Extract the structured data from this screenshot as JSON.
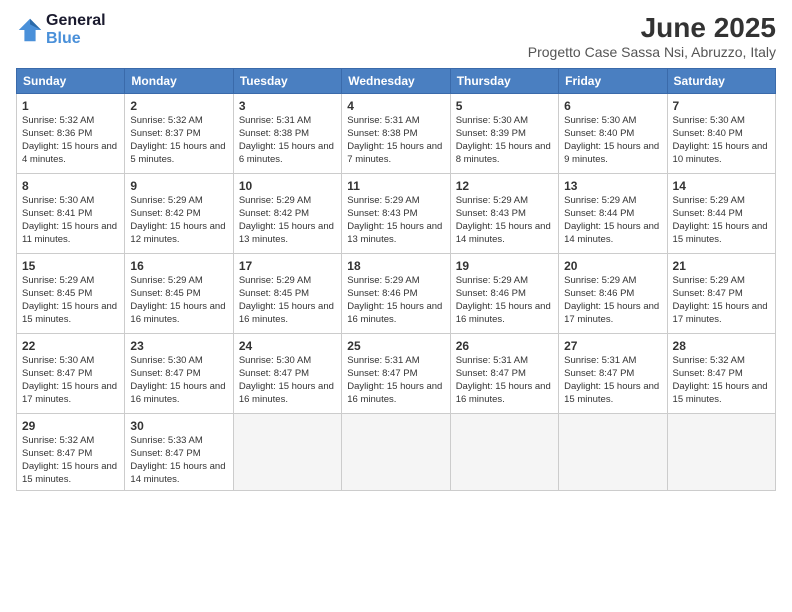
{
  "logo": {
    "line1": "General",
    "line2": "Blue"
  },
  "title": "June 2025",
  "subtitle": "Progetto Case Sassa Nsi, Abruzzo, Italy",
  "days_of_week": [
    "Sunday",
    "Monday",
    "Tuesday",
    "Wednesday",
    "Thursday",
    "Friday",
    "Saturday"
  ],
  "weeks": [
    [
      {
        "day": "1",
        "sunrise": "5:32 AM",
        "sunset": "8:36 PM",
        "daylight": "15 hours and 4 minutes."
      },
      {
        "day": "2",
        "sunrise": "5:32 AM",
        "sunset": "8:37 PM",
        "daylight": "15 hours and 5 minutes."
      },
      {
        "day": "3",
        "sunrise": "5:31 AM",
        "sunset": "8:38 PM",
        "daylight": "15 hours and 6 minutes."
      },
      {
        "day": "4",
        "sunrise": "5:31 AM",
        "sunset": "8:38 PM",
        "daylight": "15 hours and 7 minutes."
      },
      {
        "day": "5",
        "sunrise": "5:30 AM",
        "sunset": "8:39 PM",
        "daylight": "15 hours and 8 minutes."
      },
      {
        "day": "6",
        "sunrise": "5:30 AM",
        "sunset": "8:40 PM",
        "daylight": "15 hours and 9 minutes."
      },
      {
        "day": "7",
        "sunrise": "5:30 AM",
        "sunset": "8:40 PM",
        "daylight": "15 hours and 10 minutes."
      }
    ],
    [
      {
        "day": "8",
        "sunrise": "5:30 AM",
        "sunset": "8:41 PM",
        "daylight": "15 hours and 11 minutes."
      },
      {
        "day": "9",
        "sunrise": "5:29 AM",
        "sunset": "8:42 PM",
        "daylight": "15 hours and 12 minutes."
      },
      {
        "day": "10",
        "sunrise": "5:29 AM",
        "sunset": "8:42 PM",
        "daylight": "15 hours and 13 minutes."
      },
      {
        "day": "11",
        "sunrise": "5:29 AM",
        "sunset": "8:43 PM",
        "daylight": "15 hours and 13 minutes."
      },
      {
        "day": "12",
        "sunrise": "5:29 AM",
        "sunset": "8:43 PM",
        "daylight": "15 hours and 14 minutes."
      },
      {
        "day": "13",
        "sunrise": "5:29 AM",
        "sunset": "8:44 PM",
        "daylight": "15 hours and 14 minutes."
      },
      {
        "day": "14",
        "sunrise": "5:29 AM",
        "sunset": "8:44 PM",
        "daylight": "15 hours and 15 minutes."
      }
    ],
    [
      {
        "day": "15",
        "sunrise": "5:29 AM",
        "sunset": "8:45 PM",
        "daylight": "15 hours and 15 minutes."
      },
      {
        "day": "16",
        "sunrise": "5:29 AM",
        "sunset": "8:45 PM",
        "daylight": "15 hours and 16 minutes."
      },
      {
        "day": "17",
        "sunrise": "5:29 AM",
        "sunset": "8:45 PM",
        "daylight": "15 hours and 16 minutes."
      },
      {
        "day": "18",
        "sunrise": "5:29 AM",
        "sunset": "8:46 PM",
        "daylight": "15 hours and 16 minutes."
      },
      {
        "day": "19",
        "sunrise": "5:29 AM",
        "sunset": "8:46 PM",
        "daylight": "15 hours and 16 minutes."
      },
      {
        "day": "20",
        "sunrise": "5:29 AM",
        "sunset": "8:46 PM",
        "daylight": "15 hours and 17 minutes."
      },
      {
        "day": "21",
        "sunrise": "5:29 AM",
        "sunset": "8:47 PM",
        "daylight": "15 hours and 17 minutes."
      }
    ],
    [
      {
        "day": "22",
        "sunrise": "5:30 AM",
        "sunset": "8:47 PM",
        "daylight": "15 hours and 17 minutes."
      },
      {
        "day": "23",
        "sunrise": "5:30 AM",
        "sunset": "8:47 PM",
        "daylight": "15 hours and 16 minutes."
      },
      {
        "day": "24",
        "sunrise": "5:30 AM",
        "sunset": "8:47 PM",
        "daylight": "15 hours and 16 minutes."
      },
      {
        "day": "25",
        "sunrise": "5:31 AM",
        "sunset": "8:47 PM",
        "daylight": "15 hours and 16 minutes."
      },
      {
        "day": "26",
        "sunrise": "5:31 AM",
        "sunset": "8:47 PM",
        "daylight": "15 hours and 16 minutes."
      },
      {
        "day": "27",
        "sunrise": "5:31 AM",
        "sunset": "8:47 PM",
        "daylight": "15 hours and 15 minutes."
      },
      {
        "day": "28",
        "sunrise": "5:32 AM",
        "sunset": "8:47 PM",
        "daylight": "15 hours and 15 minutes."
      }
    ],
    [
      {
        "day": "29",
        "sunrise": "5:32 AM",
        "sunset": "8:47 PM",
        "daylight": "15 hours and 15 minutes."
      },
      {
        "day": "30",
        "sunrise": "5:33 AM",
        "sunset": "8:47 PM",
        "daylight": "15 hours and 14 minutes."
      },
      null,
      null,
      null,
      null,
      null
    ]
  ],
  "labels": {
    "sunrise": "Sunrise:",
    "sunset": "Sunset:",
    "daylight": "Daylight:"
  }
}
